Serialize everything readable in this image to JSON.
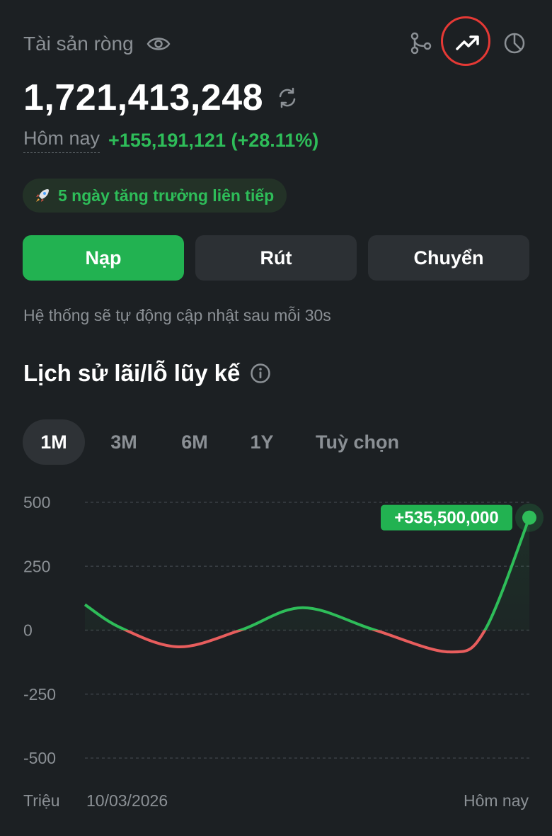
{
  "header": {
    "net_worth_label": "Tài sản ròng",
    "balance": "1,721,413,248",
    "today_label": "Hôm nay",
    "today_change": "+155,191,121 (+28.11%)"
  },
  "streak": {
    "text": "5 ngày tăng trưởng liên tiếp",
    "icon": "rocket-icon"
  },
  "actions": {
    "deposit": "Nạp",
    "withdraw": "Rút",
    "transfer": "Chuyển"
  },
  "update_note": "Hệ thống sẽ tự động cập nhật sau mỗi 30s",
  "section": {
    "title": "Lịch sử lãi/lỗ lũy kế"
  },
  "range_tabs": [
    {
      "label": "1M",
      "active": true
    },
    {
      "label": "3M",
      "active": false
    },
    {
      "label": "6M",
      "active": false
    },
    {
      "label": "1Y",
      "active": false
    },
    {
      "label": "Tuỳ chọn",
      "active": false
    }
  ],
  "view_icons": [
    "branch-icon",
    "trend-up-icon",
    "pie-chart-icon"
  ],
  "colors": {
    "accent": "#22b251",
    "positive": "#2ebd59",
    "negative": "#e85d5d",
    "background": "#1c2023"
  },
  "chart_data": {
    "type": "line",
    "unit": "Triệu",
    "y_ticks": [
      "500",
      "250",
      "0",
      "-250",
      "-500"
    ],
    "ylim": [
      -500,
      500
    ],
    "x_start_label": "10/03/2026",
    "x_end_label": "Hôm nay",
    "final_value_label": "+535,500,000",
    "points": [
      {
        "t": 0.0,
        "y": 100
      },
      {
        "t": 0.08,
        "y": 10
      },
      {
        "t": 0.21,
        "y": -65
      },
      {
        "t": 0.35,
        "y": 0
      },
      {
        "t": 0.49,
        "y": 88
      },
      {
        "t": 0.65,
        "y": 2
      },
      {
        "t": 0.82,
        "y": -85
      },
      {
        "t": 0.9,
        "y": 0
      },
      {
        "t": 1.0,
        "y": 440
      }
    ]
  }
}
